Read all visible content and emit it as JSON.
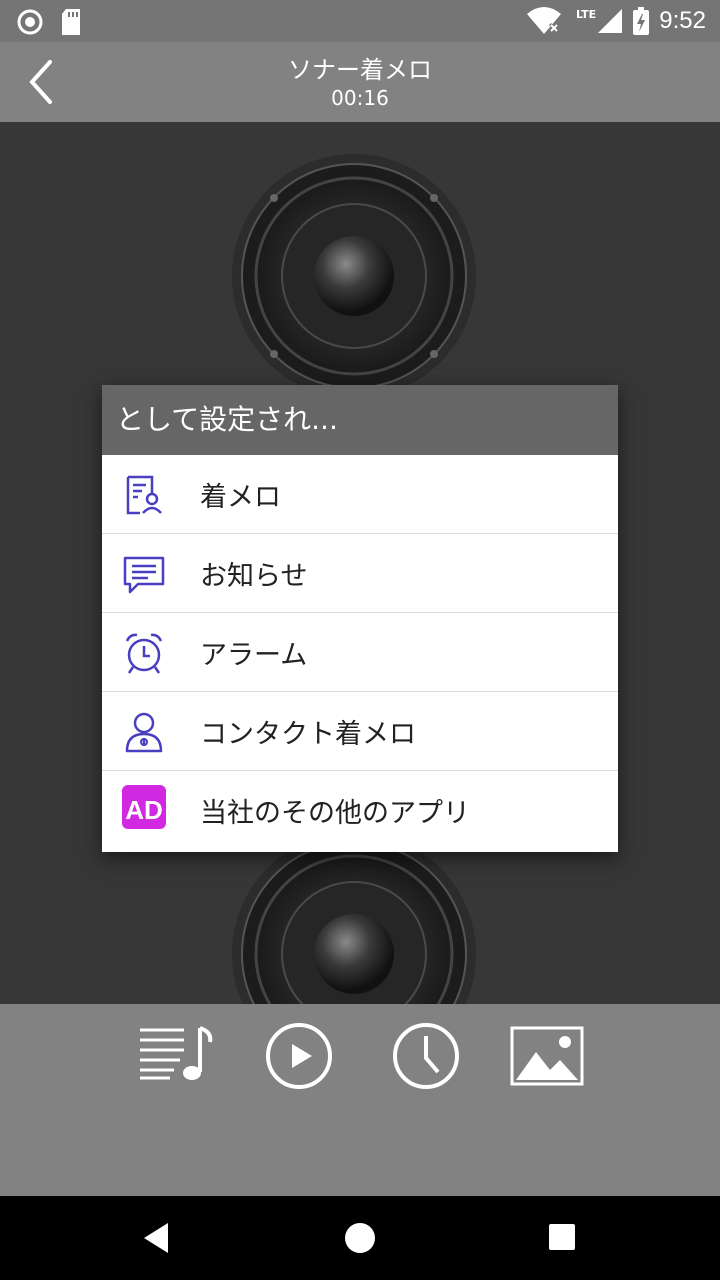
{
  "status_bar": {
    "time": "9:52",
    "network": "LTE",
    "icons": [
      "record-icon",
      "sd-card-icon",
      "wifi-icon",
      "signal-icon",
      "battery-icon"
    ]
  },
  "header": {
    "title": "ソナー着メロ",
    "subtitle": "00:16"
  },
  "dialog": {
    "title": "として設定され...",
    "items": [
      {
        "label": "着メロ",
        "icon": "ringtone-icon"
      },
      {
        "label": "お知らせ",
        "icon": "notification-icon"
      },
      {
        "label": "アラーム",
        "icon": "alarm-icon"
      },
      {
        "label": "コンタクト着メロ",
        "icon": "contact-ringtone-icon"
      },
      {
        "label": "当社のその他のアプリ",
        "icon": "ad-icon",
        "badge": "AD"
      }
    ]
  },
  "toolbar": {
    "buttons": [
      "playlist-icon",
      "play-icon",
      "clock-icon",
      "image-icon"
    ]
  },
  "colors": {
    "accent": "#4a3fc0",
    "ad_badge": "#d128e2",
    "header_bg": "#828282",
    "dialog_title_bg": "#666666"
  }
}
